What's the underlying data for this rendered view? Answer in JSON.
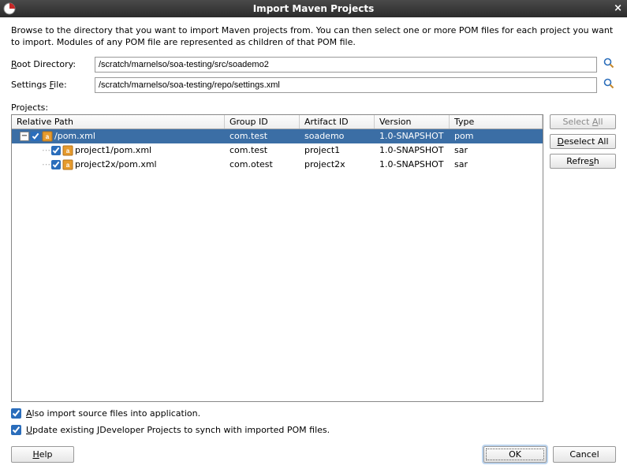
{
  "window": {
    "title": "Import Maven Projects",
    "close": "×"
  },
  "intro": "Browse to the directory that you want to import Maven projects from. You can then select one or more POM files for each project you want to import. Modules of any POM file are represented as children of that POM file.",
  "rootDir": {
    "label_pre": "",
    "label_u": "R",
    "label_post": "oot Directory:",
    "value": "/scratch/marnelso/soa-testing/src/soademo2"
  },
  "settings": {
    "label_pre": "Settings ",
    "label_u": "F",
    "label_post": "ile:",
    "value": "/scratch/marnelso/soa-testing/repo/settings.xml"
  },
  "projects": {
    "label_pre": "Pro",
    "label_u": "j",
    "label_post": "ects:"
  },
  "columns": {
    "path": "Relative Path",
    "gid": "Group ID",
    "aid": "Artifact ID",
    "ver": "Version",
    "type": "Type"
  },
  "rows": [
    {
      "indent": 0,
      "expander": "−",
      "checked": true,
      "path": "/pom.xml",
      "gid": "com.test",
      "aid": "soademo",
      "ver": "1.0-SNAPSHOT",
      "type": "pom",
      "selected": true
    },
    {
      "indent": 1,
      "expander": "",
      "checked": true,
      "path": "project1/pom.xml",
      "gid": "com.test",
      "aid": "project1",
      "ver": "1.0-SNAPSHOT",
      "type": "sar",
      "selected": false
    },
    {
      "indent": 1,
      "expander": "",
      "checked": true,
      "path": "project2x/pom.xml",
      "gid": "com.otest",
      "aid": "project2x",
      "ver": "1.0-SNAPSHOT",
      "type": "sar",
      "selected": false
    }
  ],
  "side": {
    "selectAll_pre": "Select ",
    "selectAll_u": "A",
    "selectAll_post": "ll",
    "deselectAll_u": "D",
    "deselectAll_post": "eselect All",
    "refresh_pre": "Refre",
    "refresh_u": "s",
    "refresh_post": "h"
  },
  "opt1": {
    "u": "A",
    "rest": "lso import source files into application."
  },
  "opt2": {
    "u": "U",
    "rest": "pdate existing JDeveloper Projects to synch with imported POM files."
  },
  "buttons": {
    "help_u": "H",
    "help_rest": "elp",
    "ok": "OK",
    "cancel": "Cancel"
  }
}
